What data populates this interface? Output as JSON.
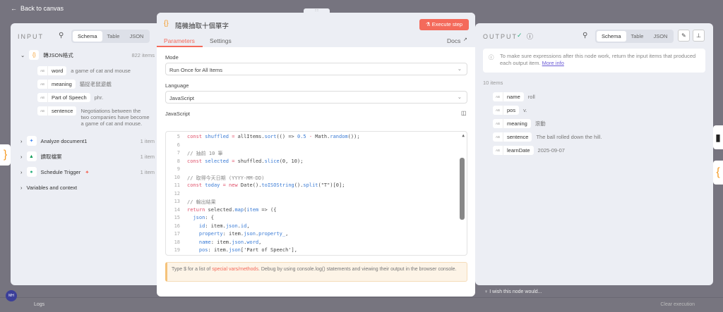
{
  "top": {
    "back_label": "Back to canvas",
    "drag_handle": "::::"
  },
  "input": {
    "title": "INPUT",
    "tabs": [
      "Schema",
      "Table",
      "JSON"
    ],
    "nodes": [
      {
        "name": "轉JSON格式",
        "count": "822 items",
        "icon": "{}"
      },
      {
        "name": "Analyze document1",
        "count": "1 item"
      },
      {
        "name": "讀取檔案",
        "count": "1 item"
      },
      {
        "name": "Schedule Trigger",
        "count": "1 item"
      }
    ],
    "fields": [
      {
        "key": "word",
        "value": "a game of cat and mouse"
      },
      {
        "key": "meaning",
        "value": "貓捉老鼠遊戲"
      },
      {
        "key": "Part of Speech",
        "value": "phr."
      },
      {
        "key": "sentence",
        "value": "Negotiations between the two companies have become a game of cat and mouse."
      }
    ],
    "type_badge": "AB",
    "variables": "Variables and context"
  },
  "modal": {
    "title": "隨機抽取十個單字",
    "execute": "Execute step",
    "tabs": {
      "parameters": "Parameters",
      "settings": "Settings",
      "docs": "Docs"
    },
    "mode_label": "Mode",
    "mode_value": "Run Once for All Items",
    "language_label": "Language",
    "language_value": "JavaScript",
    "code_label": "JavaScript",
    "code_lines": [
      {
        "n": "5",
        "html": "<span class='kw'>const</span> <span class='fn'>shuffled</span> <span class='kw'>=</span> allItems.<span class='fn'>sort</span>(() =&gt; <span class='fn'>0.5</span> <span class='kw'>-</span> Math.<span class='fn'>random</span>());"
      },
      {
        "n": "6",
        "html": ""
      },
      {
        "n": "7",
        "html": "<span class='cm'>// 抽前 10 筆</span>"
      },
      {
        "n": "8",
        "html": "<span class='kw'>const</span> <span class='fn'>selected</span> <span class='kw'>=</span> shuffled.<span class='fn'>slice</span>(0, 10);"
      },
      {
        "n": "9",
        "html": ""
      },
      {
        "n": "10",
        "html": "<span class='cm'>// 取得今天日期 (YYYY-MM-DD)</span>"
      },
      {
        "n": "11",
        "html": "<span class='kw'>const</span> <span class='fn'>today</span> <span class='kw'>=</span> <span class='kw'>new</span> Date().<span class='fn'>toISOString</span>().<span class='fn'>split</span>(\"T\")[0];"
      },
      {
        "n": "12",
        "html": ""
      },
      {
        "n": "13",
        "html": "<span class='cm'>// 輸出結果</span>"
      },
      {
        "n": "14",
        "html": "<span class='kw'>return</span> selected.<span class='fn'>map</span>(<span class='fn'>item</span> =&gt; ({"
      },
      {
        "n": "15",
        "html": "  <span class='fn'>json</span>: {"
      },
      {
        "n": "16",
        "html": "    <span class='fn'>id</span>: item.<span class='fn'>json</span>.<span class='fn'>id</span>,"
      },
      {
        "n": "17",
        "html": "    <span class='fn'>property</span>: item.<span class='fn'>json</span>.<span class='fn'>property_</span>,"
      },
      {
        "n": "18",
        "html": "    <span class='fn'>name</span>: item.<span class='fn'>json</span>.<span class='fn'>word</span>,"
      },
      {
        "n": "19",
        "html": "    <span class='fn'>pos</span>: item.<span class='fn'>json</span>['Part of Speech'],"
      }
    ],
    "hint_pre": "Type $ for a list of ",
    "hint_link": "special vars/methods",
    "hint_post": ". Debug by using console.log() statements and viewing their output in the browser console."
  },
  "output": {
    "title": "OUTPUT",
    "tabs": [
      "Schema",
      "Table",
      "JSON"
    ],
    "info": "To make sure expressions after this node work, return the input items that produced each output item.",
    "info_link": "More info",
    "count": "10 items",
    "fields": [
      {
        "key": "name",
        "value": "roll"
      },
      {
        "key": "pos",
        "value": "v."
      },
      {
        "key": "meaning",
        "value": "滾動"
      },
      {
        "key": "sentence",
        "value": "The ball rolled down the hill."
      },
      {
        "key": "learnDate",
        "value": "2025-09-07"
      }
    ]
  },
  "bottom": {
    "wish": "I wish this node would...",
    "logs": "Logs",
    "clear": "Clear execution",
    "avatar": "MH"
  }
}
